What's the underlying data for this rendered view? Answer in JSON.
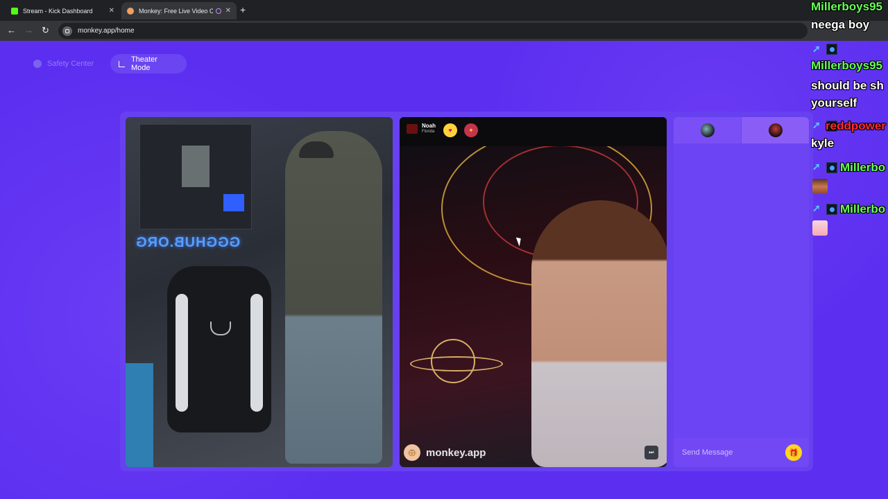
{
  "browser": {
    "tabs": [
      {
        "title": "Stream - Kick Dashboard",
        "active": false,
        "favicon": "kick-icon"
      },
      {
        "title": "Monkey: Free Live Video Ch",
        "active": true,
        "favicon": "monkey-icon"
      }
    ],
    "url": "monkey.app/home",
    "close_glyph": "✕",
    "new_tab_glyph": "+"
  },
  "header": {
    "safety_label": "Safety Center",
    "theater_label": "Theater Mode"
  },
  "video_right": {
    "peer_name": "Noah",
    "peer_location": "Florida",
    "watermark": "monkey.app",
    "watermark_icon": "🐵",
    "heart_glyph": "♥",
    "gift_glyph": "✦",
    "skip_glyph": "⏭"
  },
  "video_left": {
    "neon_sign": "GGGHUB.ORG"
  },
  "chat_panel": {
    "message_placeholder": "Send Message",
    "gift_glyph": "🎁"
  },
  "stream_chat": [
    {
      "user": "Millerboys95",
      "text": "neega boy",
      "color": "#68ff57"
    },
    {
      "user": "Millerboys95",
      "text": "should be sh yourself",
      "color": "#68ff57"
    },
    {
      "user": "reddpower",
      "text": "kyle",
      "color": "#ff2d2d"
    },
    {
      "user": "Millerbo",
      "text": "",
      "emote": "face-emote",
      "color": "#68ff57"
    },
    {
      "user": "Millerbo",
      "text": "",
      "emote": "gift-emote",
      "color": "#68ff57"
    }
  ],
  "colors": {
    "page_bg": "#5b2ef0",
    "accent_yellow": "#ffd51f",
    "chat_green": "#68ff57",
    "chat_red": "#ff2d2d"
  }
}
